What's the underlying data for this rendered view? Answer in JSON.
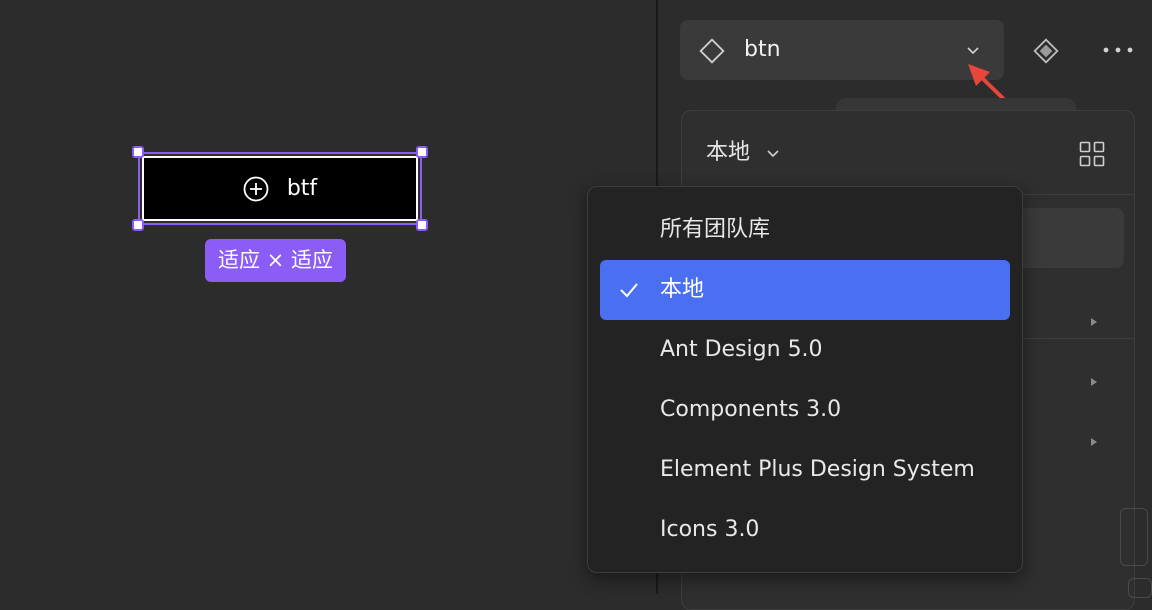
{
  "canvas": {
    "selected_button": {
      "label": "btf",
      "icon": "plus-circle-icon"
    },
    "size_badge": "适应 × 适应"
  },
  "toolbar": {
    "component_name": "btn",
    "component_icon": "component-diamond-outline-icon",
    "dropdown_icon": "chevron-down-icon",
    "main_component_icon": "component-diamond-filled-icon",
    "more_icon": "more-dots-icon"
  },
  "library_panel": {
    "source_label": "本地",
    "grid_icon": "grid-view-icon"
  },
  "library_menu": {
    "items": [
      {
        "label": "所有团队库",
        "selected": false
      },
      {
        "label": "本地",
        "selected": true
      },
      {
        "label": "Ant Design 5.0",
        "selected": false
      },
      {
        "label": "Components 3.0",
        "selected": false
      },
      {
        "label": "Element Plus Design System",
        "selected": false
      },
      {
        "label": "Icons 3.0",
        "selected": false
      }
    ],
    "selected_color": "#4a6ff0"
  },
  "colors": {
    "selection": "#8b5cf6",
    "annotation_arrow": "#e8453c"
  }
}
